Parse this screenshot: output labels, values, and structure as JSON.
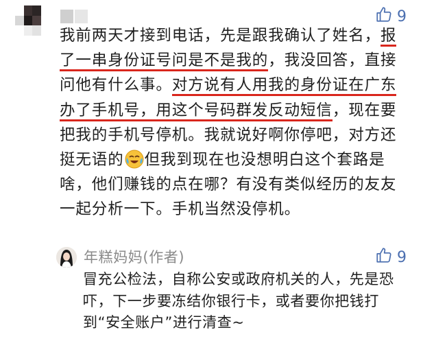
{
  "comment": {
    "like_count": "9",
    "segments": [
      {
        "text": "我前两天才接到电话，先是跟我确认了姓名，",
        "underline": false
      },
      {
        "text": "报了一串身份证号问是不是我的",
        "underline": true
      },
      {
        "text": "，我没回答，直接问他有什么事。",
        "underline": false
      },
      {
        "text": "对方说有人用我的身份证在广东办了手机号，用这个号码群发反动短信",
        "underline": true
      },
      {
        "text": "，现在要把我的手机号停机。我就说好啊你停吧，对方还挺无语的",
        "underline": false
      },
      {
        "emoji": "tears-of-joy-emoji"
      },
      {
        "text": "但我到现在也没想明白这个套路是啥，他们赚钱的点在哪？有没有类似经历的友友一起分析一下。手机当然没停机。",
        "underline": false
      }
    ]
  },
  "reply": {
    "author_name": "年糕妈妈(作者)",
    "like_count": "9",
    "text": "冒充公检法，自称公安或政府机关的人，先是恐吓，下一步要冻结你银行卡，或者要你把钱打到“安全账户”进行清查~"
  },
  "colors": {
    "underline": "#d9261c",
    "like_icon": "#4b6fb0",
    "reply_name": "#8a8a8a"
  }
}
